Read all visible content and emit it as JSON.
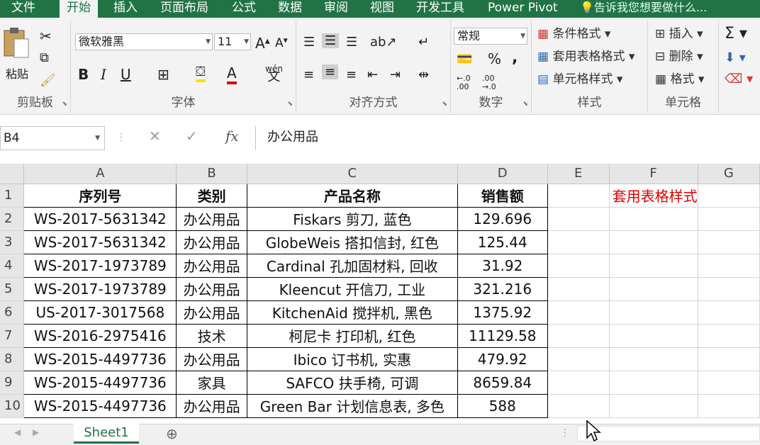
{
  "tabs": [
    "文件",
    "开始",
    "插入",
    "页面布局",
    "公式",
    "数据",
    "审阅",
    "视图",
    "开发工具",
    "Power Pivot"
  ],
  "tell_me": "告诉我您想要做什么...",
  "clipboard": {
    "paste": "粘贴",
    "label": "剪贴板"
  },
  "font": {
    "name": "微软雅黑",
    "size": "11",
    "label": "字体",
    "wen": "wén",
    "wen_char": "文"
  },
  "alignment": {
    "label": "对齐方式"
  },
  "number": {
    "format": "常规",
    "label": "数字"
  },
  "styles": {
    "cond": "条件格式",
    "table": "套用表格格式",
    "cell": "单元格样式",
    "label": "样式"
  },
  "cells": {
    "insert": "插入",
    "delete": "删除",
    "format": "格式",
    "label": "单元格"
  },
  "name_box": "B4",
  "formula": "办公用品",
  "col_headers": [
    "A",
    "B",
    "C",
    "D",
    "E",
    "F",
    "G"
  ],
  "rows": [
    {
      "n": "1",
      "a": "序列号",
      "b": "类别",
      "c": "产品名称",
      "d": "销售额",
      "f": "套用表格样式"
    },
    {
      "n": "2",
      "a": "WS-2017-5631342",
      "b": "办公用品",
      "c": "Fiskars 剪刀, 蓝色",
      "d": "129.696",
      "f": ""
    },
    {
      "n": "3",
      "a": "WS-2017-5631342",
      "b": "办公用品",
      "c": "GlobeWeis 搭扣信封, 红色",
      "d": "125.44",
      "f": ""
    },
    {
      "n": "4",
      "a": "WS-2017-1973789",
      "b": "办公用品",
      "c": "Cardinal 孔加固材料, 回收",
      "d": "31.92",
      "f": ""
    },
    {
      "n": "5",
      "a": "WS-2017-1973789",
      "b": "办公用品",
      "c": "Kleencut 开信刀, 工业",
      "d": "321.216",
      "f": ""
    },
    {
      "n": "6",
      "a": "US-2017-3017568",
      "b": "办公用品",
      "c": "KitchenAid 搅拌机, 黑色",
      "d": "1375.92",
      "f": ""
    },
    {
      "n": "7",
      "a": "WS-2016-2975416",
      "b": "技术",
      "c": "柯尼卡 打印机, 红色",
      "d": "11129.58",
      "f": ""
    },
    {
      "n": "8",
      "a": "WS-2015-4497736",
      "b": "办公用品",
      "c": "Ibico 订书机, 实惠",
      "d": "479.92",
      "f": ""
    },
    {
      "n": "9",
      "a": "WS-2015-4497736",
      "b": "家具",
      "c": "SAFCO 扶手椅, 可调",
      "d": "8659.84",
      "f": ""
    },
    {
      "n": "10",
      "a": "WS-2015-4497736",
      "b": "办公用品",
      "c": "Green Bar 计划信息表, 多色",
      "d": "588",
      "f": ""
    }
  ],
  "sheet_tab": "Sheet1",
  "colors": {
    "accent": "#217346",
    "note": "#e00000"
  }
}
